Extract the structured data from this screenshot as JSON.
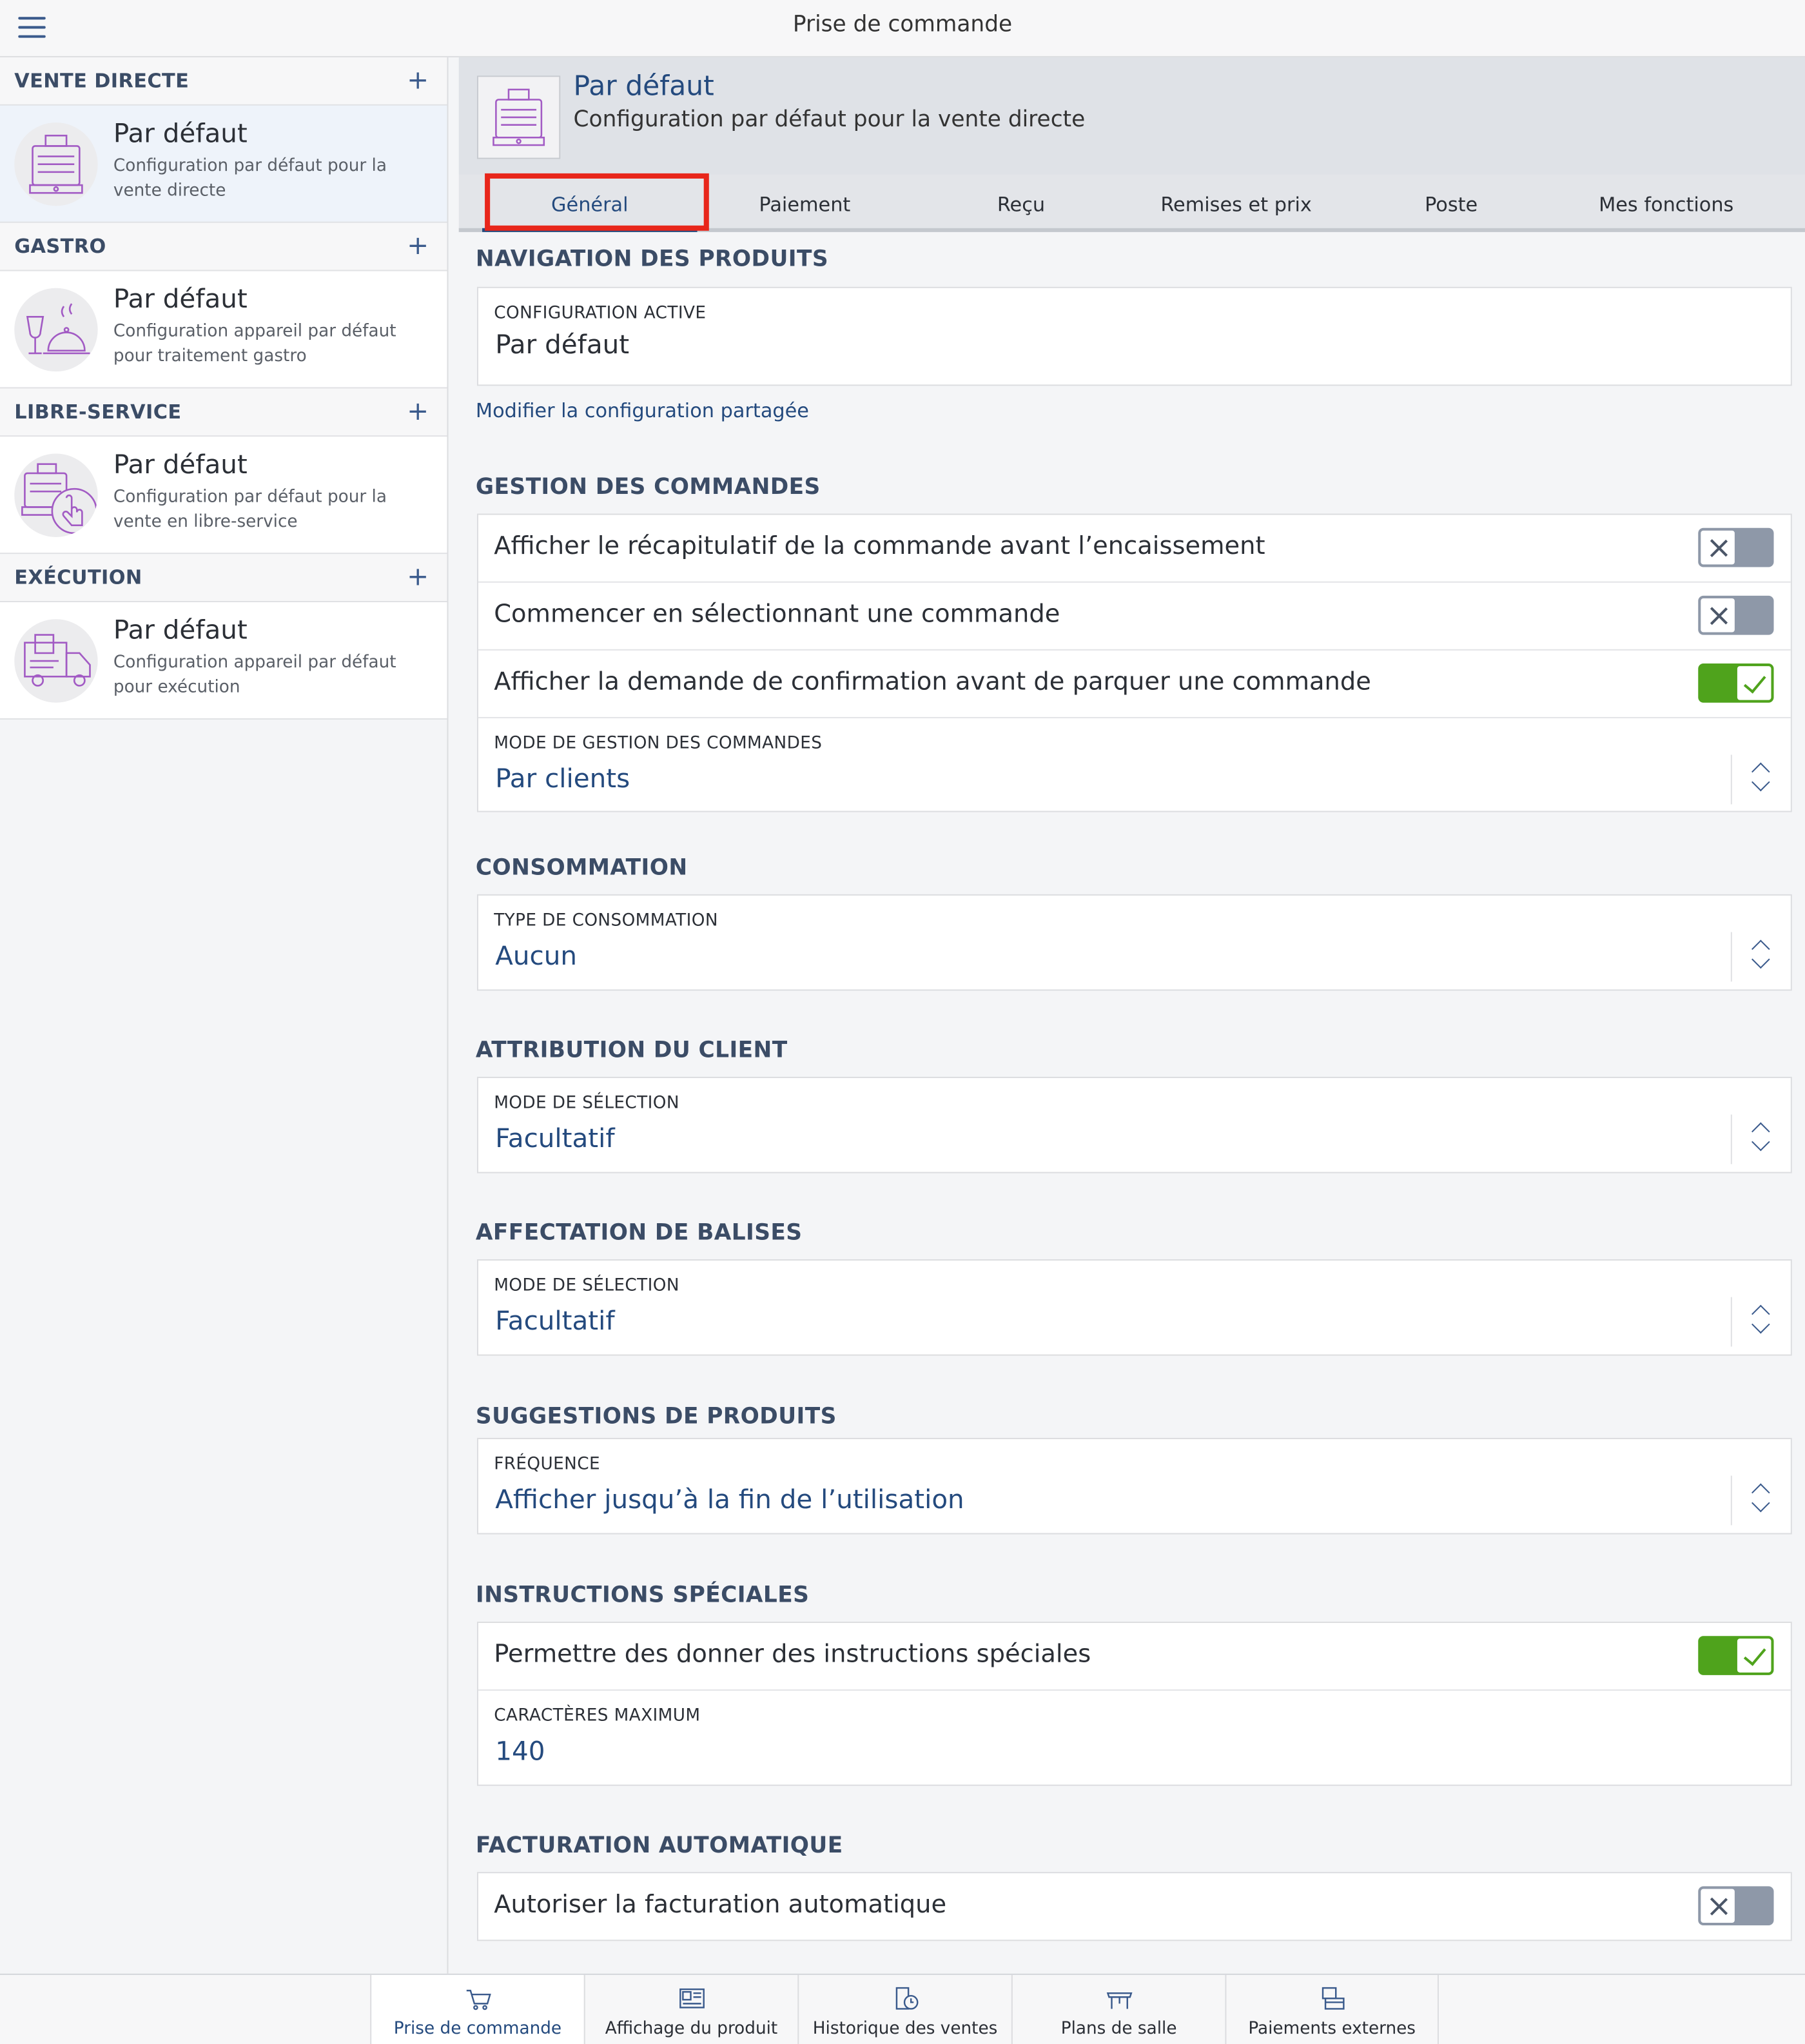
{
  "app": {
    "title": "Prise de commande"
  },
  "sidebar": {
    "sections": [
      {
        "title": "VENTE DIRECTE",
        "item_title": "Par défaut",
        "item_desc": "Configuration par défaut pour la vente directe",
        "icon": "cash-register-icon"
      },
      {
        "title": "GASTRO",
        "item_title": "Par défaut",
        "item_desc": "Configuration appareil par défaut pour traitement gastro",
        "icon": "wine-glass-cloche-icon"
      },
      {
        "title": "LIBRE-SERVICE",
        "item_title": "Par défaut",
        "item_desc": "Configuration par défaut pour la vente en libre-service",
        "icon": "self-service-register-icon"
      },
      {
        "title": "EXÉCUTION",
        "item_title": "Par défaut",
        "item_desc": "Configuration appareil par défaut pour exécution",
        "icon": "delivery-truck-icon"
      }
    ]
  },
  "header": {
    "title": "Par défaut",
    "subtitle": "Configuration par défaut pour la vente directe"
  },
  "tabs": [
    "Général",
    "Paiement",
    "Reçu",
    "Remises et prix",
    "Poste",
    "Mes fonctions"
  ],
  "active_tab": "Général",
  "sections": {
    "navigation": {
      "title": "NAVIGATION DES PRODUITS",
      "caption": "CONFIGURATION ACTIVE",
      "value": "Par défaut",
      "link": "Modifier la configuration partagée"
    },
    "orders": {
      "title": "GESTION DES COMMANDES",
      "toggles": [
        {
          "label": "Afficher le récapitulatif de la commande avant l’encaissement",
          "on": false
        },
        {
          "label": "Commencer en sélectionnant une commande",
          "on": false
        },
        {
          "label": "Afficher la demande de confirmation avant de parquer une commande",
          "on": true
        }
      ],
      "caption": "MODE DE GESTION DES COMMANDES",
      "value": "Par clients"
    },
    "consumption": {
      "title": "CONSOMMATION",
      "caption": "TYPE DE CONSOMMATION",
      "value": "Aucun"
    },
    "customer": {
      "title": "ATTRIBUTION DU CLIENT",
      "caption": "MODE DE SÉLECTION",
      "value": "Facultatif"
    },
    "tags": {
      "title": "AFFECTATION DE BALISES",
      "caption": "MODE DE SÉLECTION",
      "value": "Facultatif"
    },
    "suggestions": {
      "title": "SUGGESTIONS DE PRODUITS",
      "caption": "FRÉQUENCE",
      "value": "Afficher jusqu’à la fin de l’utilisation"
    },
    "instructions": {
      "title": "INSTRUCTIONS SPÉCIALES",
      "toggle_label": "Permettre des donner des instructions spéciales",
      "toggle_on": true,
      "caption": "CARACTÈRES MAXIMUM",
      "value": "140"
    },
    "billing": {
      "title": "FACTURATION AUTOMATIQUE",
      "toggle_label": "Autoriser la facturation automatique",
      "toggle_on": false
    }
  },
  "bottom_tabs": [
    {
      "label": "Prise de commande",
      "icon": "basket-icon"
    },
    {
      "label": "Affichage du produit",
      "icon": "product-display-icon"
    },
    {
      "label": "Historique des ventes",
      "icon": "sales-history-icon"
    },
    {
      "label": "Plans de salle",
      "icon": "table-icon"
    },
    {
      "label": "Paiements externes",
      "icon": "external-payment-icon"
    }
  ],
  "colors": {
    "accent": "#244a7e",
    "toggle_on": "#4fa31c",
    "toggle_off": "#8e98a8",
    "highlight": "#e8261b",
    "illustration": "#a25bc4"
  }
}
